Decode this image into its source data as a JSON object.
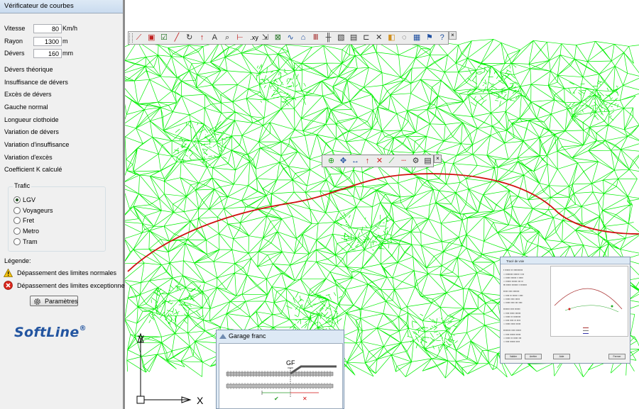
{
  "panel": {
    "title": "Vérificateur de courbes",
    "fields": [
      {
        "label": "Vitesse",
        "value": "80",
        "unit": "Km/h"
      },
      {
        "label": "Rayon",
        "value": "1300",
        "unit": "m"
      },
      {
        "label": "Dévers",
        "value": "160",
        "unit": "mm"
      }
    ],
    "info_items": [
      "Dévers théorique",
      "Insuffisance de dévers",
      "Excès de dévers",
      "Gauche normal",
      "Longueur clothoide",
      "Variation de dévers",
      "Variation d'insuffisance",
      "Variation d'excès",
      "Coefficient K calculé"
    ],
    "trafic": {
      "label": "Trafic",
      "options": [
        "LGV",
        "Voyageurs",
        "Fret",
        "Metro",
        "Tram"
      ],
      "selected": "LGV"
    },
    "legend": {
      "title": "Légende:",
      "items": [
        {
          "icon": "warning-triangle-icon",
          "text": "Dépassement des limites normales"
        },
        {
          "icon": "error-circle-icon",
          "text": "Dépassement des limites exceptionnelles"
        }
      ]
    },
    "params_button": "Paramètres",
    "logo": {
      "name": "SoftLine",
      "mark": "®",
      "color": "#2355a0"
    }
  },
  "toolbar": {
    "icons": [
      "split-line-icon",
      "select-box-icon",
      "check-box-icon",
      "draw-line-icon",
      "rotate-icon",
      "arrow-up-icon",
      "text-icon",
      "zoom-icon",
      "ruler-icon",
      "xy-coordinates-icon",
      "dimension-icon",
      "grid-icon",
      "curve-icon",
      "tag-icon",
      "bridge-icon",
      "fence-icon",
      "hatch-icon",
      "document-icon",
      "crop-icon",
      "cross-icon",
      "layers-icon",
      "chat-icon",
      "export-icon",
      "flag-icon",
      "help-icon"
    ],
    "xy_label": ".xy"
  },
  "toolbar2": {
    "icons": [
      "crosshair-icon",
      "move-icon",
      "horizontal-arrows-icon",
      "arrow-up-icon",
      "delete-icon",
      "chart-icon",
      "dashed-line-icon",
      "settings-icon",
      "document-icon"
    ]
  },
  "garage_dialog": {
    "title": "Garage franc",
    "label": "GF"
  },
  "trace_dialog": {
    "title": "Tracé de voie",
    "buttons": [
      "Valider",
      "Arrêter",
      "Aide",
      "Fermer"
    ]
  },
  "axes": {
    "x": "X",
    "y": "Y"
  },
  "colors": {
    "mesh": "#00ee00",
    "alignment": "#d01010",
    "logo": "#2355a0"
  }
}
